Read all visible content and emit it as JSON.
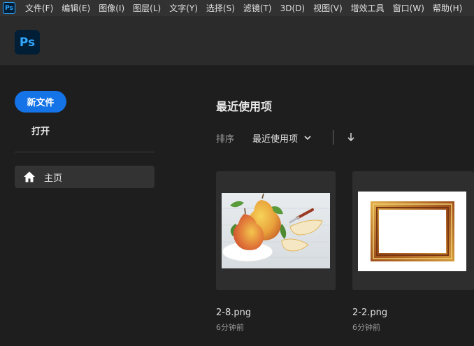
{
  "app": {
    "icon_text": "Ps"
  },
  "menu": {
    "items": [
      "文件(F)",
      "编辑(E)",
      "图像(I)",
      "图层(L)",
      "文字(Y)",
      "选择(S)",
      "滤镜(T)",
      "3D(D)",
      "视图(V)",
      "增效工具",
      "窗口(W)",
      "帮助(H)"
    ]
  },
  "sidebar": {
    "new_file_label": "新文件",
    "open_label": "打开",
    "nav": {
      "home_label": "主页"
    }
  },
  "main": {
    "section_title": "最近使用项",
    "sort": {
      "label": "排序",
      "selected": "最近使用项"
    },
    "files": [
      {
        "name": "2-8.png",
        "time": "6分钟前"
      },
      {
        "name": "2-2.png",
        "time": "6分钟前"
      }
    ]
  },
  "colors": {
    "accent": "#1473e6",
    "ps_blue": "#31a8ff",
    "ps_dark": "#001e36",
    "background": "#1e1e1e",
    "menubar": "#323232",
    "header": "#2b2b2b",
    "card": "#2e2e2e"
  }
}
